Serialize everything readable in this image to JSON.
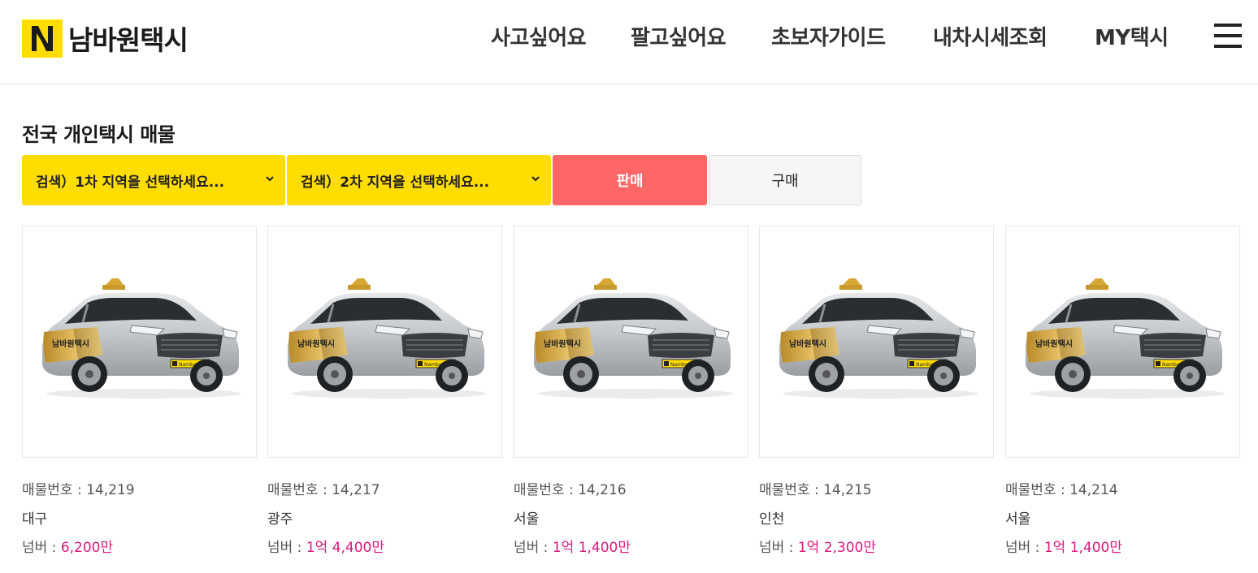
{
  "brand": {
    "name": "남바원택시",
    "badge_letter": "N",
    "color": "#ffdd00"
  },
  "nav": {
    "items": [
      "사고싶어요",
      "팔고싶어요",
      "초보자가이드",
      "내차시세조회",
      "MY택시"
    ]
  },
  "section": {
    "title": "전국 개인택시 매물"
  },
  "filters": {
    "region1_placeholder": "검색）1차 지역을 선택하세요...",
    "region2_placeholder": "검색）2차 지역을 선택하세요...",
    "sell_label": "판매",
    "buy_label": "구매",
    "sell_color": "#ff6666",
    "select_color": "#ffdd00"
  },
  "listings": [
    {
      "num_label": "매물번호 : ",
      "num": "14,219",
      "region": "대구",
      "price_label": "넘버 : ",
      "price": "6,200만"
    },
    {
      "num_label": "매물번호 : ",
      "num": "14,217",
      "region": "광주",
      "price_label": "넘버 : ",
      "price": "1억 4,400만"
    },
    {
      "num_label": "매물번호 : ",
      "num": "14,216",
      "region": "서울",
      "price_label": "넘버 : ",
      "price": "1억 1,400만"
    },
    {
      "num_label": "매물번호 : ",
      "num": "14,215",
      "region": "인천",
      "price_label": "넘버 : ",
      "price": "1억 2,300만"
    },
    {
      "num_label": "매물번호 : ",
      "num": "14,214",
      "region": "서울",
      "price_label": "넘버 : ",
      "price": "1억 1,400만"
    }
  ],
  "car_image": {
    "door_text": "남바원택시",
    "plate_text": "NambaOne Taxi",
    "price_color": "#e0197d"
  }
}
